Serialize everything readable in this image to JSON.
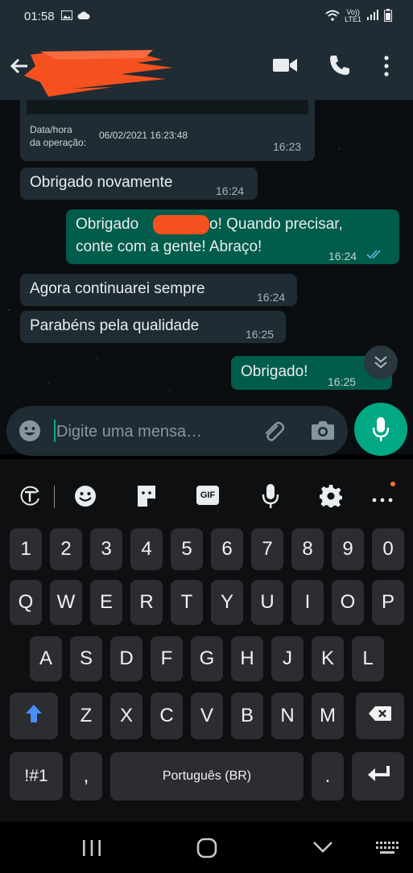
{
  "status_bar": {
    "time": "01:58",
    "left_icons": [
      "image-icon",
      "cloud-icon"
    ],
    "right_icons": [
      "wifi-icon",
      "volte-icon",
      "signal-icon",
      "battery-icon"
    ],
    "volte_label": "Vo))\nLTE1"
  },
  "header": {
    "contact_name": "",
    "actions": [
      "video-call-icon",
      "phone-icon",
      "more-vert-icon"
    ]
  },
  "messages": [
    {
      "type": "forwarded-card",
      "label_line1": "Data/hora",
      "label_line2": "da operação:",
      "value": "06/02/2021 16:23:48",
      "time": "16:23"
    },
    {
      "type": "incoming",
      "text": "Obrigado novamente",
      "time": "16:24"
    },
    {
      "type": "outgoing",
      "line1_a": "Obrigado",
      "line1_b": "o! Quando precisar,",
      "line2": "conte com a gente! Abraço!",
      "time": "16:24",
      "read": true
    },
    {
      "type": "incoming",
      "text": "Agora continuarei sempre",
      "time": "16:24"
    },
    {
      "type": "incoming",
      "text": "Parabéns pela qualidade",
      "time": "16:25"
    },
    {
      "type": "outgoing",
      "text": "Obrigado!",
      "time": "16:25"
    }
  ],
  "composer": {
    "placeholder": "Digite uma mensa…",
    "value": ""
  },
  "keyboard": {
    "toolbar": [
      "text-translate-icon",
      "emoji-icon",
      "sticker-icon",
      "gif-icon",
      "voice-input-icon",
      "settings-icon",
      "more-horiz-icon"
    ],
    "gif_label": "GIF",
    "rows": [
      [
        "1",
        "2",
        "3",
        "4",
        "5",
        "6",
        "7",
        "8",
        "9",
        "0"
      ],
      [
        "Q",
        "W",
        "E",
        "R",
        "T",
        "Y",
        "U",
        "I",
        "O",
        "P"
      ],
      [
        "A",
        "S",
        "D",
        "F",
        "G",
        "H",
        "J",
        "K",
        "L"
      ],
      [
        "Z",
        "X",
        "C",
        "V",
        "B",
        "N",
        "M"
      ]
    ],
    "symbols_label": "!#1",
    "comma_label": ",",
    "space_label": "Português (BR)",
    "period_label": "."
  },
  "colors": {
    "header_bg": "#1f2c34",
    "incoming_bubble": "#1f2c34",
    "outgoing_bubble": "#005c4b",
    "accent": "#00a884",
    "read_tick": "#53bdeb",
    "shift_arrow": "#4a8ef7"
  }
}
